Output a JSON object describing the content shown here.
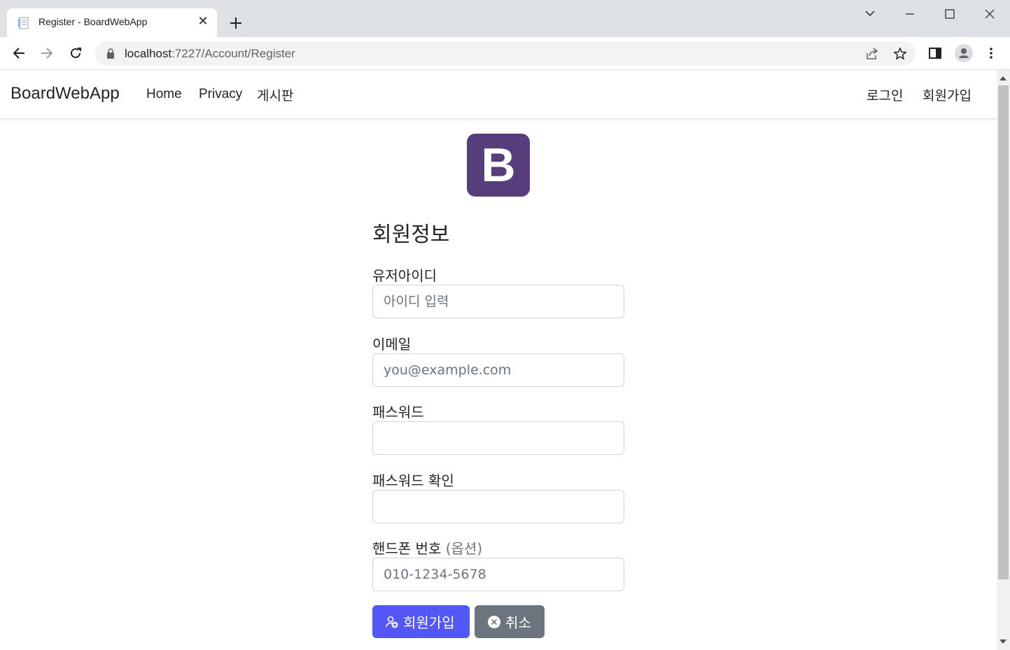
{
  "browser": {
    "tab_title": "Register - BoardWebApp",
    "close_tab_symbol": "✕",
    "url_host": "localhost",
    "url_path": ":7227/Account/Register"
  },
  "navbar": {
    "brand": "BoardWebApp",
    "left_links": [
      "Home",
      "Privacy",
      "게시판"
    ],
    "right_links": [
      "로그인",
      "회원가입"
    ]
  },
  "logo": {
    "letter": "B",
    "color": "#563d7c"
  },
  "form": {
    "heading": "회원정보",
    "fields": [
      {
        "label": "유저아이디",
        "placeholder": "아이디 입력",
        "type": "text"
      },
      {
        "label": "이메일",
        "placeholder": "you@example.com",
        "type": "email"
      },
      {
        "label": "패스워드",
        "placeholder": "",
        "type": "password"
      },
      {
        "label": "패스워드 확인",
        "placeholder": "",
        "type": "password"
      },
      {
        "label": "핸드폰 번호",
        "label_note": "(옵션)",
        "placeholder": "010-1234-5678",
        "type": "tel"
      }
    ],
    "submit_label": "회원가입",
    "cancel_label": "취소"
  },
  "colors": {
    "primary": "#5457f8",
    "secondary": "#6c757d"
  },
  "icons": [
    "favicon-icon",
    "close-tab-icon",
    "new-tab-icon",
    "tab-search-icon",
    "minimize-icon",
    "maximize-icon",
    "window-close-icon",
    "back-icon",
    "forward-icon",
    "reload-icon",
    "lock-icon",
    "share-icon",
    "bookmark-star-icon",
    "side-panel-icon",
    "profile-icon",
    "kebab-menu-icon",
    "person-add-icon",
    "x-circle-icon"
  ]
}
